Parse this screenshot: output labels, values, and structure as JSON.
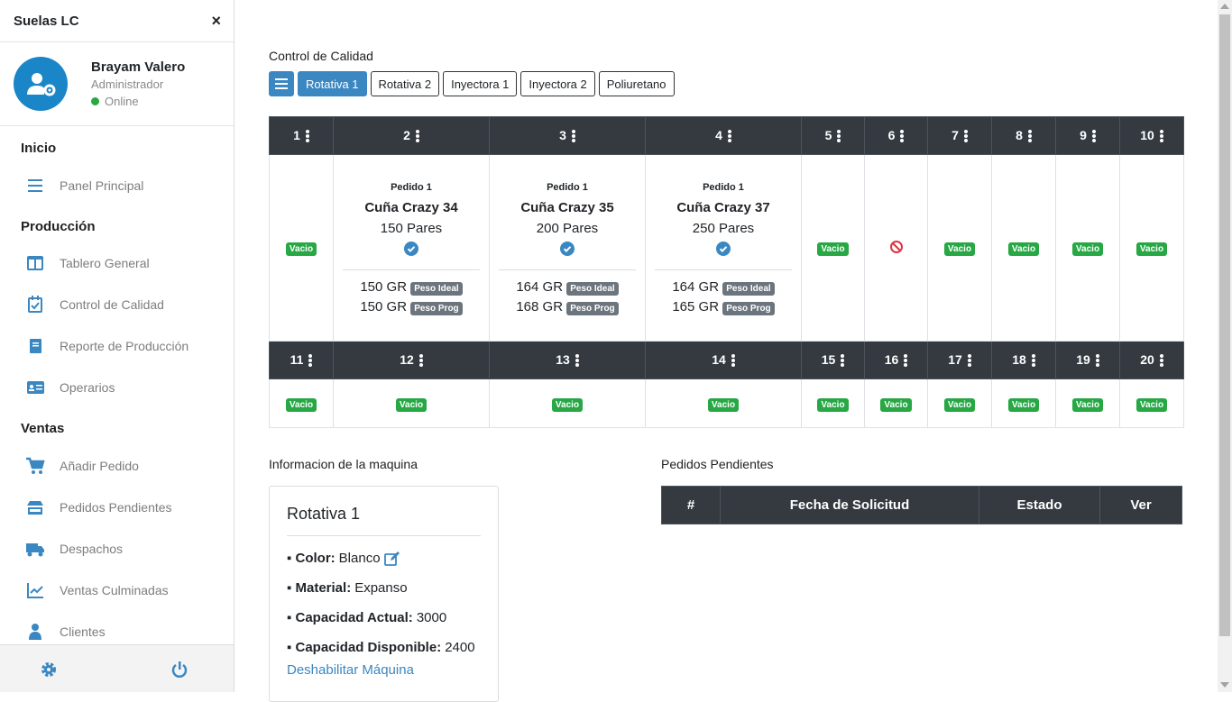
{
  "sidebar": {
    "brand": "Suelas LC",
    "close": "×",
    "user": {
      "name": "Brayam Valero",
      "role": "Administrador",
      "status": "Online"
    },
    "sections": {
      "inicio": "Inicio",
      "produccion": "Producción",
      "ventas": "Ventas"
    },
    "items": [
      {
        "label": "Panel Principal",
        "icon": "menu-icon"
      },
      {
        "label": "Tablero General",
        "icon": "columns-icon"
      },
      {
        "label": "Control de Calidad",
        "icon": "calendar-check-icon"
      },
      {
        "label": "Reporte de Producción",
        "icon": "book-icon"
      },
      {
        "label": "Operarios",
        "icon": "id-card-icon"
      },
      {
        "label": "Añadir Pedido",
        "icon": "cart-icon"
      },
      {
        "label": "Pedidos Pendientes",
        "icon": "store-icon"
      },
      {
        "label": "Despachos",
        "icon": "truck-icon"
      },
      {
        "label": "Ventas Culminadas",
        "icon": "chart-line-icon"
      },
      {
        "label": "Clientes",
        "icon": "user-icon"
      }
    ]
  },
  "main": {
    "title": "Control de Calidad",
    "tabs": [
      "Rotativa 1",
      "Rotativa 2",
      "Inyectora 1",
      "Inyectora 2",
      "Poliuretano"
    ],
    "active_tab": "Rotativa 1",
    "row1_headers": [
      "1",
      "2",
      "3",
      "4",
      "5",
      "6",
      "7",
      "8",
      "9",
      "10"
    ],
    "row2_headers": [
      "11",
      "12",
      "13",
      "14",
      "15",
      "16",
      "17",
      "18",
      "19",
      "20"
    ],
    "empty_label": "Vacio",
    "slots": [
      {
        "pedido": "Pedido 1",
        "producto": "Cuña Crazy 34",
        "pares": "150 Pares",
        "peso_ideal": "150 GR",
        "peso_prog": "150 GR"
      },
      {
        "pedido": "Pedido 1",
        "producto": "Cuña Crazy 35",
        "pares": "200 Pares",
        "peso_ideal": "164 GR",
        "peso_prog": "168 GR"
      },
      {
        "pedido": "Pedido 1",
        "producto": "Cuña Crazy 37",
        "pares": "250 Pares",
        "peso_ideal": "164 GR",
        "peso_prog": "165 GR"
      }
    ],
    "peso_ideal_label": "Peso Ideal",
    "peso_prog_label": "Peso Prog"
  },
  "machine": {
    "section_title": "Informacion de la maquina",
    "name": "Rotativa 1",
    "color_label": "Color:",
    "color": "Blanco",
    "material_label": "Material:",
    "material": "Expanso",
    "cap_actual_label": "Capacidad Actual:",
    "cap_actual": "3000",
    "cap_disp_label": "Capacidad Disponible:",
    "cap_disp": "2400",
    "disable_link": "Deshabilitar Máquina"
  },
  "pending": {
    "title": "Pedidos Pendientes",
    "columns": [
      "#",
      "Fecha de Solicitud",
      "Estado",
      "Ver"
    ]
  },
  "colors": {
    "primary": "#3a87c2",
    "dark": "#343a40",
    "success": "#28a745",
    "secondary": "#6c757d"
  }
}
